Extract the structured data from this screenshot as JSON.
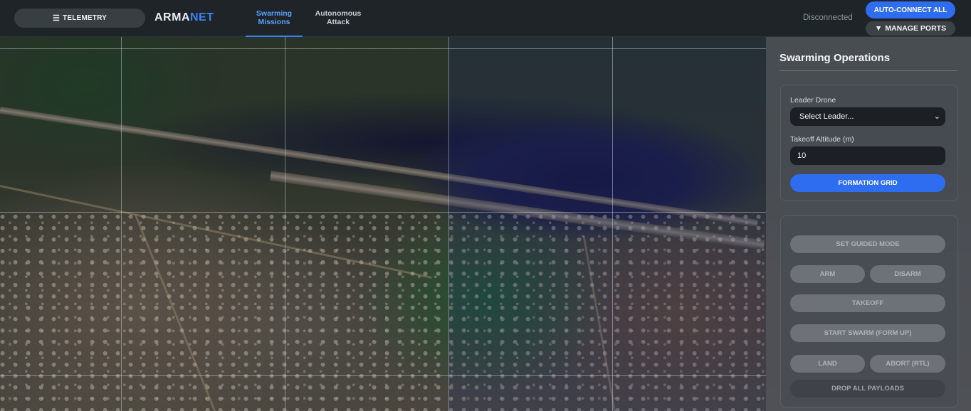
{
  "topbar": {
    "telemetry_label": "TELEMETRY",
    "telemetry_icon": "menu-icon",
    "brand_part1": "ARMA",
    "brand_part2": "NET",
    "tabs": [
      {
        "label_line1": "Swarming",
        "label_line2": "Missions",
        "active": true
      },
      {
        "label_line1": "Autonomous",
        "label_line2": "Attack",
        "active": false
      }
    ],
    "connection_status": "Disconnected",
    "auto_connect_label": "AUTO-CONNECT ALL",
    "manage_ports_label": "MANAGE PORTS",
    "manage_ports_icon": "caret-down-icon"
  },
  "panel": {
    "title": "Swarming Operations",
    "leader_label": "Leader Drone",
    "leader_selected": "Select Leader...",
    "altitude_label": "Takeoff Altitude (m)",
    "altitude_value": "10",
    "formation_label": "FORMATION GRID",
    "set_guided_label": "SET GUIDED MODE",
    "arm_label": "ARM",
    "disarm_label": "DISARM",
    "takeoff_label": "TAKEOFF",
    "start_swarm_label": "START SWARM (FORM UP)",
    "land_label": "LAND",
    "abort_label": "ABORT (RTL)",
    "drop_payloads_label": "DROP ALL PAYLOADS"
  },
  "colors": {
    "accent": "#2f6df0",
    "brand_highlight": "#3b82f6",
    "active_tab": "#5aa0ff"
  }
}
